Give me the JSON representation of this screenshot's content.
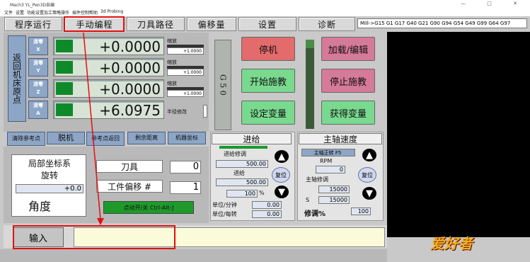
{
  "window": {
    "title": "Mach3 YL_Pen3D自编",
    "controls": "— □ ✕"
  },
  "menu": [
    "文件",
    "设置",
    "功能设置",
    "加工策略",
    "操作",
    "插件控制",
    "帮助",
    "3d Probing"
  ],
  "tabs": [
    "程序运行",
    "手动编程",
    "刀具路径",
    "偏移量",
    "设置",
    "诊断"
  ],
  "gcode_line": "Mill->G15  G1 G17 G40 G21 G90 G94 G54 G49 G99 G64 G97",
  "home_label": "返回机床原点",
  "axes": [
    {
      "zero": "清零",
      "axis": "X",
      "value": "+0.0000",
      "scale_label": "缩放",
      "scale": "+1.0000"
    },
    {
      "zero": "清零",
      "axis": "Y",
      "value": "+0.0000",
      "scale_label": "缩放",
      "scale": "+1.0000"
    },
    {
      "zero": "清零",
      "axis": "Z",
      "value": "+0.0000",
      "scale_label": "缩放",
      "scale": "+1.0000"
    },
    {
      "zero": "清零",
      "axis": "A",
      "value": "+6.0975",
      "scale_label": "半径修改"
    }
  ],
  "bottom_buttons": [
    "清除参考点",
    "脱机",
    "参考点返回",
    "剩余距离",
    "机器坐标"
  ],
  "g50": "G 5 0",
  "buttons": {
    "stop": "停机",
    "load": "加载/编辑",
    "start": "开始施教",
    "end": "停止施教",
    "set_var": "设定变量",
    "get_var": "获得变量"
  },
  "feed": {
    "title": "进给",
    "override_label": "进给修调",
    "override": "500.00",
    "feed_label": "进给",
    "feed": "500.00",
    "percent": "100",
    "pct_sign": "%",
    "per_min_label": "单位/分钟",
    "per_min": "0.00",
    "per_rev_label": "单位/每转",
    "per_rev": "0.00",
    "reset": "复位"
  },
  "spindle": {
    "title": "主轴速度",
    "cw": "主轴正转 F5",
    "rpm_label": "RPM",
    "rpm": "0",
    "override_label": "主轴修调",
    "override": "15000",
    "s_label": "S",
    "s": "15000",
    "pct_label": "修调%",
    "pct": "100",
    "reset": "复位"
  },
  "local": {
    "title": "局部坐标系\n旋转",
    "value": "+0.0",
    "angle": "角度"
  },
  "tool": {
    "label": "刀具",
    "value": "0",
    "offset_label": "工件偏移 #",
    "offset": "1",
    "jog": "点动开/关 Ctrl-Alt-J"
  },
  "input": {
    "label": "输入"
  },
  "logo": "爱好者"
}
